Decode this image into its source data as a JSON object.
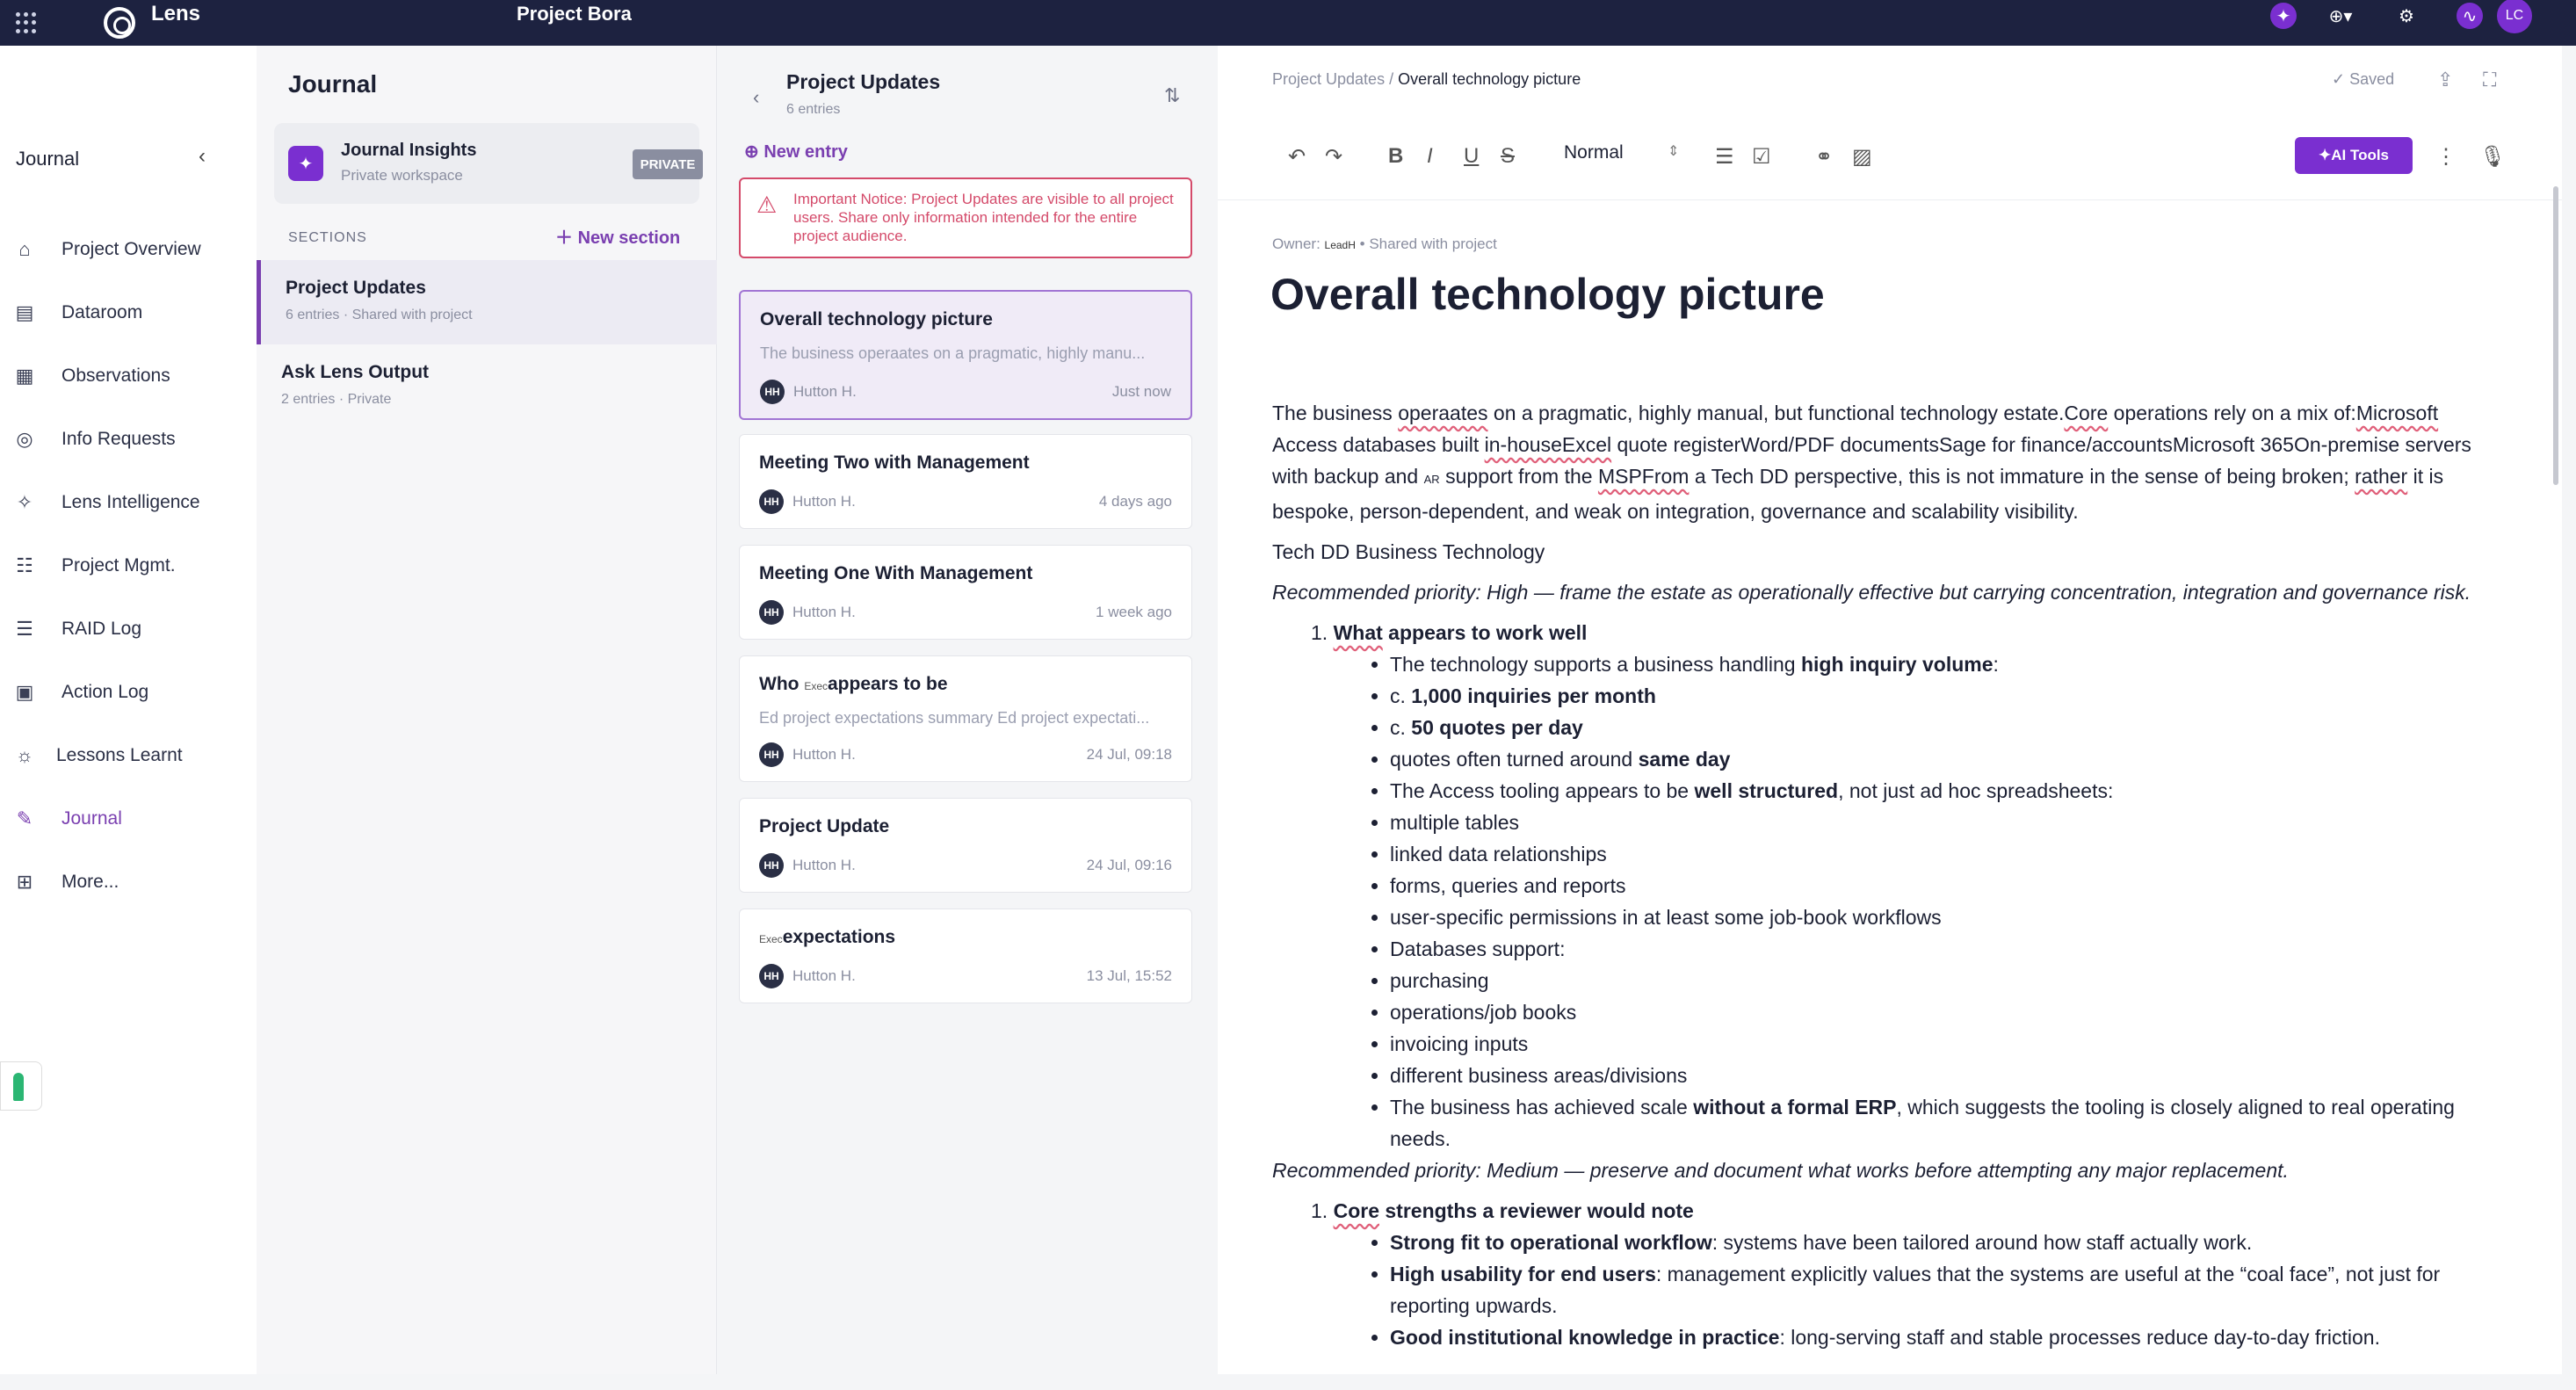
{
  "topbar": {
    "brand": "Lens",
    "project": "Project Bora",
    "avatar": "LC"
  },
  "leftnav": {
    "header": "Journal",
    "items": [
      {
        "label": "Project Overview",
        "icon": "home-icon"
      },
      {
        "label": "Dataroom",
        "icon": "folder-icon"
      },
      {
        "label": "Observations",
        "icon": "grid-icon"
      },
      {
        "label": "Info Requests",
        "icon": "request-icon"
      },
      {
        "label": "Lens Intelligence",
        "icon": "sparkle-icon"
      },
      {
        "label": "Project Mgmt.",
        "icon": "kanban-icon"
      },
      {
        "label": "RAID Log",
        "icon": "raid-icon"
      },
      {
        "label": "Action Log",
        "icon": "action-icon"
      },
      {
        "label": "Lessons Learnt",
        "icon": "bulb-icon"
      },
      {
        "label": "Journal",
        "icon": "journal-icon"
      },
      {
        "label": "More...",
        "icon": "more-icon"
      }
    ]
  },
  "journal": {
    "title": "Journal",
    "insights": {
      "title": "Journal Insights",
      "subtitle": "Private workspace",
      "badge": "PRIVATE"
    },
    "sections_label": "SECTIONS",
    "new_section": "New section",
    "sections": [
      {
        "name": "Project Updates",
        "entries": "6 entries",
        "visibility": "Shared with project"
      },
      {
        "name": "Ask Lens Output",
        "entries": "2 entries",
        "visibility": "Private"
      }
    ]
  },
  "entries": {
    "title": "Project Updates",
    "count": "6 entries",
    "new_entry": "New entry",
    "notice": "Important Notice: Project Updates are visible to all project users. Share only information intended for the entire project audience.",
    "cards": [
      {
        "title": "Overall technology picture",
        "preview": "The business operaates on a pragmatic, highly manu...",
        "author": "Hutton H.",
        "initials": "HH",
        "time": "Just now"
      },
      {
        "title": "Meeting Two with Management",
        "preview": "",
        "author": "Hutton H.",
        "initials": "HH",
        "time": "4 days ago"
      },
      {
        "title": "Meeting One With Management",
        "preview": "",
        "author": "Hutton H.",
        "initials": "HH",
        "time": "1 week ago"
      },
      {
        "title_pre": "Who ",
        "title_small": "Exec",
        "title_post": "appears to be",
        "preview": "Ed project expectations summary Ed project expectati...",
        "author": "Hutton H.",
        "initials": "HH",
        "time": "24 Jul, 09:18"
      },
      {
        "title": "Project Update",
        "preview": "",
        "author": "Hutton H.",
        "initials": "HH",
        "time": "24 Jul, 09:16"
      },
      {
        "title_small": "Exec",
        "title_post": "expectations",
        "preview": "",
        "author": "Hutton H.",
        "initials": "HH",
        "time": "13 Jul, 15:52"
      }
    ]
  },
  "editor": {
    "breadcrumb_parent": "Project Updates",
    "breadcrumb_current": "Overall technology picture",
    "saved": "Saved",
    "style": "Normal",
    "ai_tools": "AI Tools",
    "owner_label": "Owner:",
    "owner": "LeadH",
    "shared": "Shared with project",
    "title": "Overall technology picture",
    "para1_a": "The business ",
    "para1_sq": "operaates",
    "para1_b": " on a pragmatic, highly manual, but functional technology estate.",
    "para1_c": "Core",
    "para1_d": " operations rely on a mix of:",
    "para1_e": "Microsoft",
    "para1_f": " Access databases built ",
    "para1_g": "in-houseExcel",
    "para1_h": " quote registerWord/PDF documentsSage for finance/accountsMicrosoft 365On-premise servers with backup and ",
    "para1_ar": "AR",
    "para1_i": " support from the ",
    "para1_j": "MSPFrom",
    "para1_k": " a Tech DD perspective, this is not immature in the sense of being broken; ",
    "para1_l": "rather",
    "para1_m": " it is bespoke, person-dependent, and weak on integration, governance and scalability visibility.",
    "heading": "Tech DD Business Technology",
    "priority1": "Recommended priority: High — frame the estate as operationally effective but carrying concentration, integration and governance risk.",
    "list1_num": "1.",
    "list1_title_a": "What",
    "list1_title_b": " appears to work well",
    "bullets1_0_a": "The technology supports a business handling ",
    "bullets1_0_b": "high inquiry volume",
    "bullets1_0_c": ":",
    "bullets1_1_a": "c. ",
    "bullets1_1_b": "1,000 inquiries per month",
    "bullets1_2_a": "c. ",
    "bullets1_2_b": "50 quotes per day",
    "bullets1_3_a": "quotes often turned around ",
    "bullets1_3_b": "same day",
    "bullets1_4_a": "The Access tooling appears to be ",
    "bullets1_4_b": "well structured",
    "bullets1_4_c": ", not just ad hoc spreadsheets:",
    "bullets1_5": "multiple tables",
    "bullets1_6": "linked data relationships",
    "bullets1_7": "forms, queries and reports",
    "bullets1_8": "user-specific permissions in at least some job-book workflows",
    "bullets1_9": "Databases support:",
    "bullets1_10": "purchasing",
    "bullets1_11": "operations/job books",
    "bullets1_12": "invoicing inputs",
    "bullets1_13": "different business areas/divisions",
    "bullets1_14_a": "The business has achieved scale ",
    "bullets1_14_b": "without a formal ERP",
    "bullets1_14_c": ", which suggests the tooling is closely aligned to real operating needs.",
    "priority2": "Recommended priority: Medium — preserve and document what works before attempting any major replacement.",
    "list2_title_a": "Core",
    "list2_title_b": " strengths a reviewer would note",
    "bullets2_0_a": "Strong fit to operational workflow",
    "bullets2_0_b": ": systems have been tailored around how staff actually work.",
    "bullets2_1_a": "High usability for end users",
    "bullets2_1_b": ": management explicitly values that the systems are useful at the “coal face”, not just for reporting upwards.",
    "bullets2_2_a": "Good institutional knowledge in practice",
    "bullets2_2_b": ": long-serving staff and stable processes reduce day-to-day friction."
  }
}
